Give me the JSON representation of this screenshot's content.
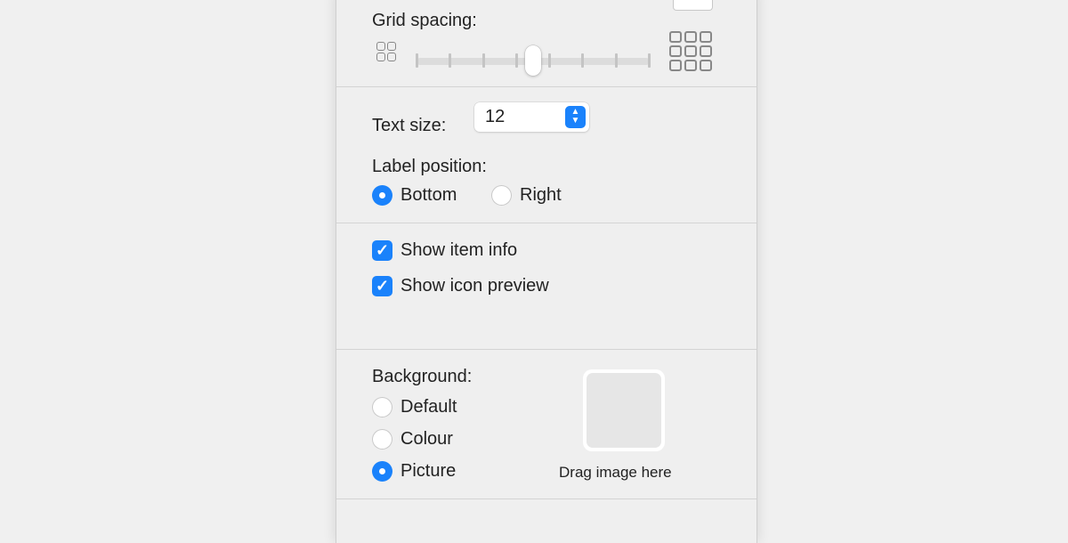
{
  "grid_spacing": {
    "label": "Grid spacing:",
    "slider_fraction": 0.5,
    "small_icon": "small-grid-icon",
    "large_icon": "large-grid-icon"
  },
  "text_size": {
    "label": "Text size:",
    "value": "12"
  },
  "label_position": {
    "label": "Label position:",
    "options": [
      {
        "label": "Bottom",
        "selected": true
      },
      {
        "label": "Right",
        "selected": false
      }
    ]
  },
  "options": [
    {
      "label": "Show item info",
      "checked": true
    },
    {
      "label": "Show icon preview",
      "checked": true
    }
  ],
  "background": {
    "label": "Background:",
    "options": [
      {
        "label": "Default",
        "selected": false
      },
      {
        "label": "Colour",
        "selected": false
      },
      {
        "label": "Picture",
        "selected": true
      }
    ],
    "drop_label": "Drag image here"
  },
  "colors": {
    "accent": "#1a82fb",
    "panel": "#efefef"
  }
}
